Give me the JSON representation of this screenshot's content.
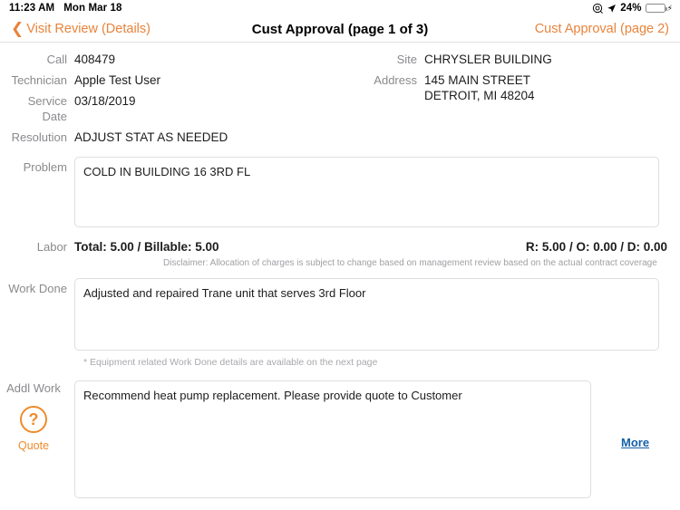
{
  "status_bar": {
    "time": "11:23 AM",
    "date": "Mon Mar 18",
    "screen_record_icon": "screen-record-icon",
    "location_icon": "location-arrow-icon",
    "battery_percent": "24%",
    "battery_level": 24,
    "charging": true
  },
  "nav": {
    "back_label": "Visit Review (Details)",
    "title": "Cust Approval (page 1 of 3)",
    "right_label": "Cust Approval (page 2)",
    "accent_color": "#e8833a"
  },
  "fields": {
    "call_label": "Call",
    "call_value": "408479",
    "technician_label": "Technician",
    "technician_value": "Apple Test User",
    "service_date_label": "Service Date",
    "service_date_value": "03/18/2019",
    "resolution_label": "Resolution",
    "resolution_value": "ADJUST STAT AS NEEDED",
    "site_label": "Site",
    "site_value": "CHRYSLER BUILDING",
    "address_label": "Address",
    "address_line1": "145 MAIN STREET",
    "address_line2": "DETROIT, MI 48204"
  },
  "problem": {
    "label": "Problem",
    "value": "COLD IN BUILDING 16 3RD FL"
  },
  "labor": {
    "label": "Labor",
    "totals": "Total: 5.00  /  Billable: 5.00",
    "breakdown": "R: 5.00  /  O: 0.00  /  D: 0.00",
    "disclaimer": "Disclaimer: Allocation of charges is subject to change based on management review based on the actual contract coverage"
  },
  "work_done": {
    "label": "Work Done",
    "value": "Adjusted and repaired Trane unit that serves 3rd Floor",
    "note": "* Equipment related Work Done details are available on the next page"
  },
  "addl_work": {
    "label": "Addl Work",
    "quote_icon": "question-mark-circle-icon",
    "quote_label": "Quote",
    "value": "Recommend heat pump replacement. Please provide quote to Customer",
    "more_label": "More",
    "more_color": "#1560a8",
    "quote_color": "#ef8b2c"
  }
}
